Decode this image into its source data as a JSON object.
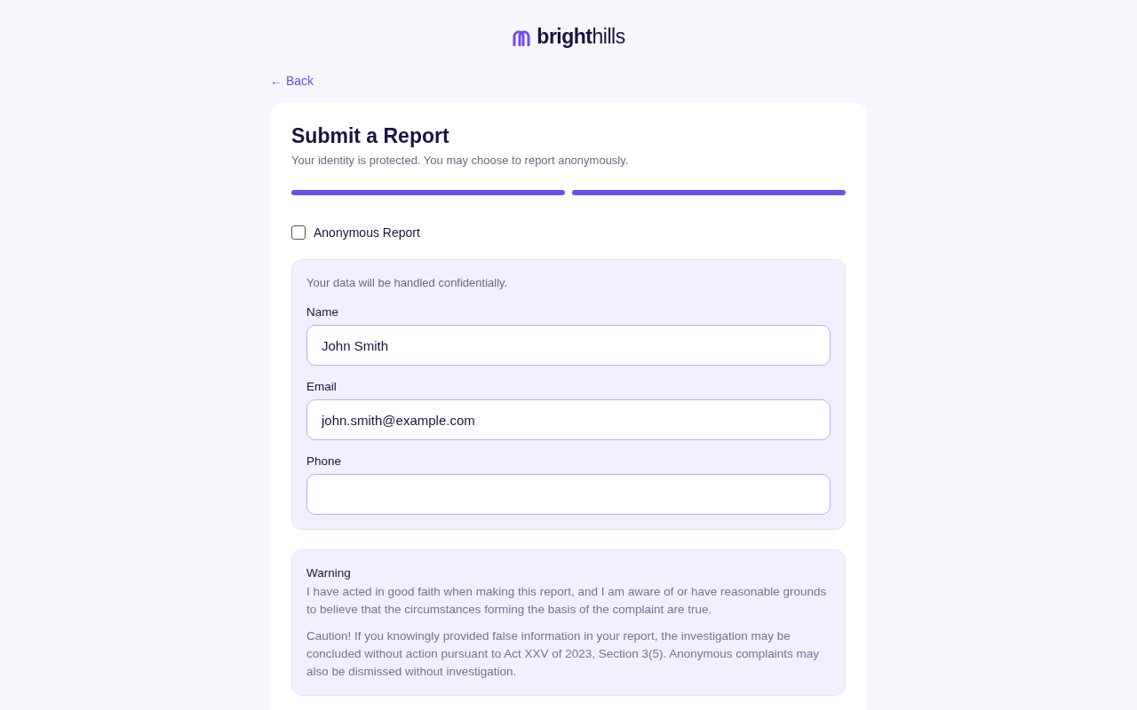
{
  "brand": {
    "bold": "bright",
    "light": "hills"
  },
  "back_link": "← Back",
  "card": {
    "title": "Submit a Report",
    "subtitle": "Your identity is protected. You may choose to report anonymously.",
    "steps": [
      {
        "complete": true
      },
      {
        "complete": true
      }
    ],
    "anonymous": {
      "label": "Anonymous Report",
      "checked": false
    },
    "contact": {
      "note": "Your data will be handled confidentially.",
      "fields": [
        {
          "label": "Name",
          "value": "John Smith"
        },
        {
          "label": "Email",
          "value": "john.smith@example.com"
        },
        {
          "label": "Phone"
        }
      ]
    },
    "warning": {
      "title": "Warning",
      "paragraphs": [
        "I have acted in good faith when making this report, and I am aware of or have reasonable grounds to believe that the circumstances forming the basis of the complaint are true.",
        "Caution! If you knowingly provided false information in your report, the investigation may be concluded without action pursuant to Act XXV of 2023, Section 3(5). Anonymous complaints may also be dismissed without investigation."
      ]
    }
  }
}
